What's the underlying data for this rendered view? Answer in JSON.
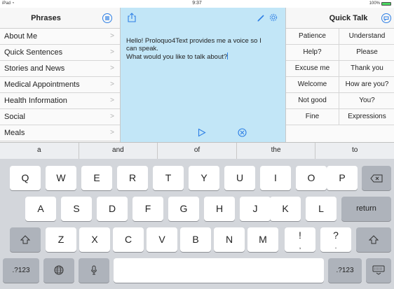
{
  "status_bar": {
    "device": "iPad",
    "time": "9:37",
    "battery": "100%"
  },
  "left_panel": {
    "title": "Phrases",
    "items": [
      {
        "label": "About Me"
      },
      {
        "label": "Quick Sentences"
      },
      {
        "label": "Stories and News"
      },
      {
        "label": "Medical Appointments"
      },
      {
        "label": "Health Information"
      },
      {
        "label": "Social"
      },
      {
        "label": "Meals"
      }
    ],
    "chevron": ">"
  },
  "text_area": {
    "content": "Hello! Proloquo4Text provides me a voice so I\ncan speak.\nWhat would you like to talk about?"
  },
  "right_panel": {
    "title": "Quick Talk",
    "cells": [
      "Patience",
      "Understand",
      "Help?",
      "Please",
      "Excuse me",
      "Thank you",
      "Welcome",
      "How are you?",
      "Not good",
      "You?",
      "Fine",
      "Expressions"
    ]
  },
  "suggestions": [
    "a",
    "and",
    "of",
    "the",
    "to"
  ],
  "keyboard": {
    "row1": [
      "Q",
      "W",
      "E",
      "R",
      "T",
      "Y",
      "U",
      "I",
      "O",
      "P"
    ],
    "row2": [
      "A",
      "S",
      "D",
      "F",
      "G",
      "H",
      "J",
      "K",
      "L"
    ],
    "row3": [
      "Z",
      "X",
      "C",
      "V",
      "B",
      "N",
      "M",
      "!",
      "?"
    ],
    "row3_sub": [
      ",",
      "."
    ],
    "return_label": "return",
    "numbers_label": ".?123",
    "numbers_label_right": ".?123"
  },
  "colors": {
    "accent": "#2d7fe5",
    "text_bg": "#c2e6f7",
    "keyboard_bg": "#d3d6db",
    "battery": "#4cd964"
  }
}
